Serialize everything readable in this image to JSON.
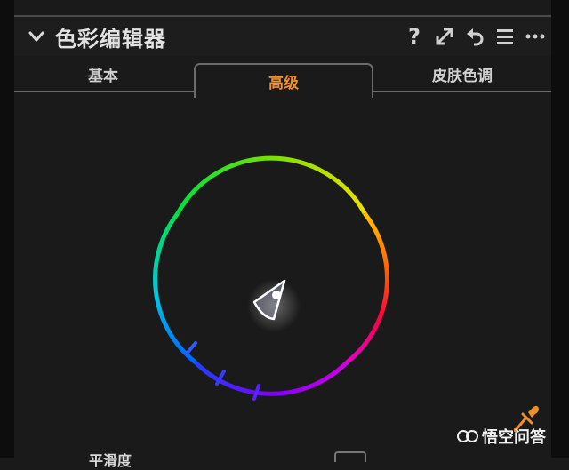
{
  "panel": {
    "title": "色彩编辑器"
  },
  "header_icons": [
    {
      "name": "help-icon",
      "glyph": "?"
    },
    {
      "name": "expand-icon"
    },
    {
      "name": "undo-icon"
    },
    {
      "name": "menu-icon"
    },
    {
      "name": "more-icon"
    }
  ],
  "tabs": [
    {
      "label": "基本",
      "active": false
    },
    {
      "label": "高级",
      "active": true
    },
    {
      "label": "皮肤色调",
      "active": false
    }
  ],
  "colors": {
    "background": "#1a1a1a",
    "active_tab": "#ef8e2a",
    "text": "#d8d8d8"
  },
  "bottom": {
    "label": "平滑度"
  },
  "watermark": {
    "text": "悟空问答"
  }
}
